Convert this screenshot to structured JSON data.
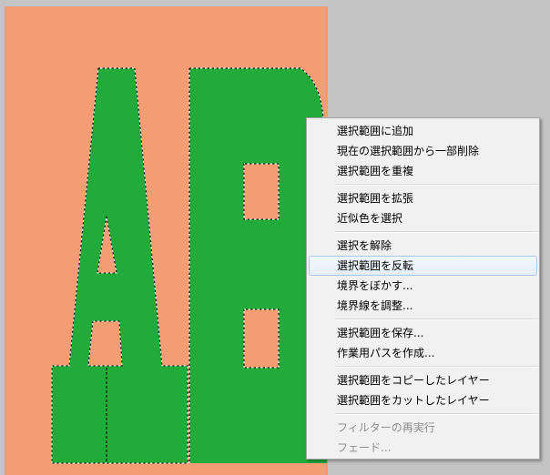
{
  "canvas": {
    "background_color": "#f49c74",
    "letters_color": "#22ab3b",
    "artwork_letters": "AB"
  },
  "context_menu": {
    "items": [
      {
        "label": "選択範囲に追加",
        "enabled": true
      },
      {
        "label": "現在の選択範囲から一部削除",
        "enabled": true
      },
      {
        "label": "選択範囲を重複",
        "enabled": true
      },
      {
        "label": "選択範囲を拡張",
        "enabled": true
      },
      {
        "label": "近似色を選択",
        "enabled": true
      },
      {
        "label": "選択を解除",
        "enabled": true
      },
      {
        "label": "選択範囲を反転",
        "enabled": true,
        "highlighted": true
      },
      {
        "label": "境界をぼかす...",
        "enabled": true
      },
      {
        "label": "境界線を調整...",
        "enabled": true
      },
      {
        "label": "選択範囲を保存...",
        "enabled": true
      },
      {
        "label": "作業用パスを作成...",
        "enabled": true
      },
      {
        "label": "選択範囲をコピーしたレイヤー",
        "enabled": true
      },
      {
        "label": "選択範囲をカットしたレイヤー",
        "enabled": true
      },
      {
        "label": "フィルターの再実行",
        "enabled": false
      },
      {
        "label": "フェード...",
        "enabled": false
      }
    ]
  }
}
